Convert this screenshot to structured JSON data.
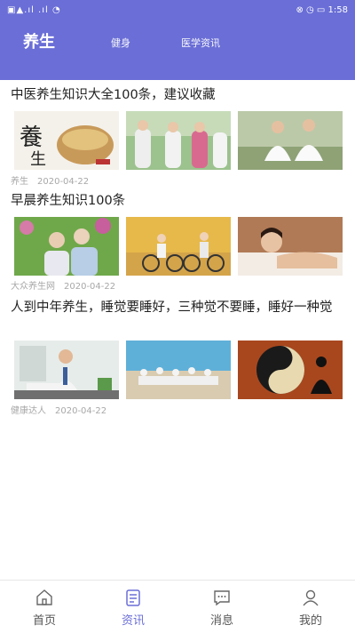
{
  "status_bar": {
    "left": "▣▲.ıl .ıl ◔",
    "right": "⊗ ◷ ▭ 1:58"
  },
  "header": {
    "tabs": [
      {
        "label": "养生",
        "active": true
      },
      {
        "label": "健身",
        "active": false
      },
      {
        "label": "医学资讯",
        "active": false
      }
    ],
    "accent_color": "#6a6ed6"
  },
  "articles": [
    {
      "title": "中医养生知识大全100条，建议收藏",
      "source": "养生",
      "date": "2020-04-22",
      "images": [
        "calligraphy-养生-and-grain-bowl",
        "elderly-people-tai-chi",
        "couple-meditating-white-clothes"
      ]
    },
    {
      "title": "早晨养生知识100条",
      "source": "大众养生网",
      "date": "2020-04-22",
      "images": [
        "elderly-couple-with-tea",
        "elderly-couple-cycling-autumn",
        "woman-spa-massage"
      ]
    },
    {
      "title": "人到中年养生，睡觉要睡好，三种觉不要睡，睡好一种觉",
      "source": "健康达人",
      "date": "2020-04-22",
      "images": [
        "man-at-office-desk",
        "group-yoga-on-beach",
        "yin-yang-meditation"
      ]
    }
  ],
  "bottom_nav": [
    {
      "label": "首页",
      "icon": "home-icon",
      "active": false
    },
    {
      "label": "资讯",
      "icon": "news-icon",
      "active": true
    },
    {
      "label": "消息",
      "icon": "message-icon",
      "active": false
    },
    {
      "label": "我的",
      "icon": "profile-icon",
      "active": false
    }
  ]
}
